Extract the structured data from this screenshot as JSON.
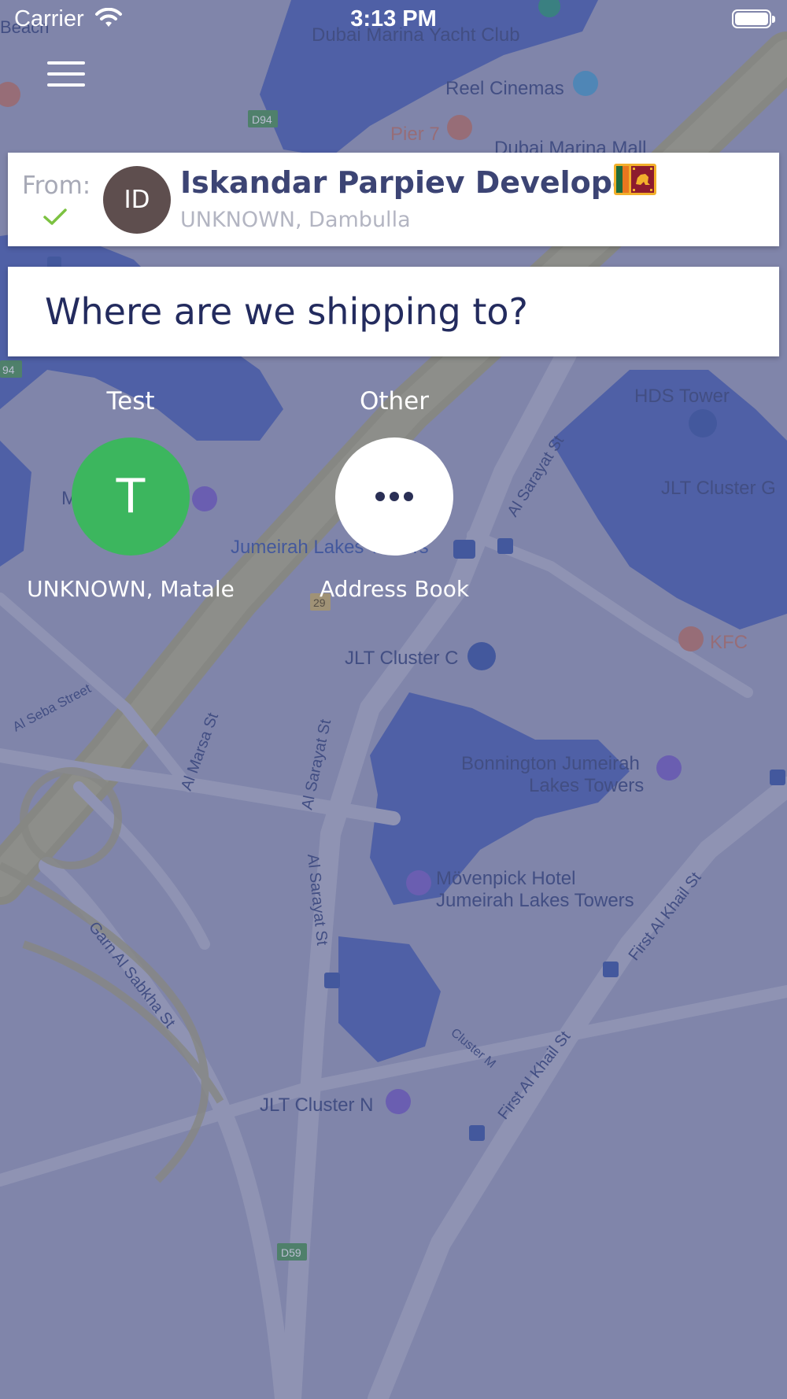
{
  "status_bar": {
    "carrier": "Carrier",
    "time": "3:13 PM"
  },
  "map": {
    "labels": {
      "beach": "Beach",
      "yacht_club": "Dubai Marina Yacht Club",
      "reel_cinemas": "Reel Cinemas",
      "pier7": "Pier 7",
      "marina_mall": "Dubai Marina Mall",
      "hds_tower": "HDS Tower",
      "jlt_g": "JLT Cluster G",
      "jumeirah_lakes": "Jumeirah Lakes Towers",
      "kfc": "KFC",
      "jlt_c": "JLT Cluster C",
      "al_seba": "Al Seba Street",
      "al_marsa": "Al Marsa St",
      "al_sarayat_1": "Al Sarayat St",
      "al_sarayat_2": "Al Sarayat St",
      "al_sarayat_3": "Al Sarayat St",
      "bonnington_1": "Bonnington Jumeirah",
      "bonnington_2": "Lakes Towers",
      "movenpick_1": "Mövenpick Hotel",
      "movenpick_2": "Jumeirah Lakes Towers",
      "first_al_khail_1": "First Al Khail St",
      "first_al_khail_2": "First Al Khail St",
      "garn": "Garn Al Sabkha St",
      "cluster_m": "Cluster M",
      "jlt_n": "JLT Cluster N",
      "d94": "D94",
      "d59": "D59",
      "r29": "29",
      "m_label": "M",
      "left_94": "94"
    }
  },
  "from_card": {
    "label": "From:",
    "avatar_initials": "ID",
    "name": "Iskandar Parpiev Developer",
    "location": "UNKNOWN, Dambulla",
    "flag": "sri-lanka-flag"
  },
  "destination": {
    "placeholder": "Where are we shipping to?"
  },
  "recipients": [
    {
      "name": "Test",
      "initial": "T",
      "subtitle": "UNKNOWN, Matale",
      "color": "#3cb65e"
    },
    {
      "name": "Other",
      "subtitle": "Address Book",
      "icon": "more-dots-icon"
    }
  ],
  "colors": {
    "accent_text": "#3c4474",
    "check_green": "#7cc241",
    "map_water": "#4f67b6"
  }
}
